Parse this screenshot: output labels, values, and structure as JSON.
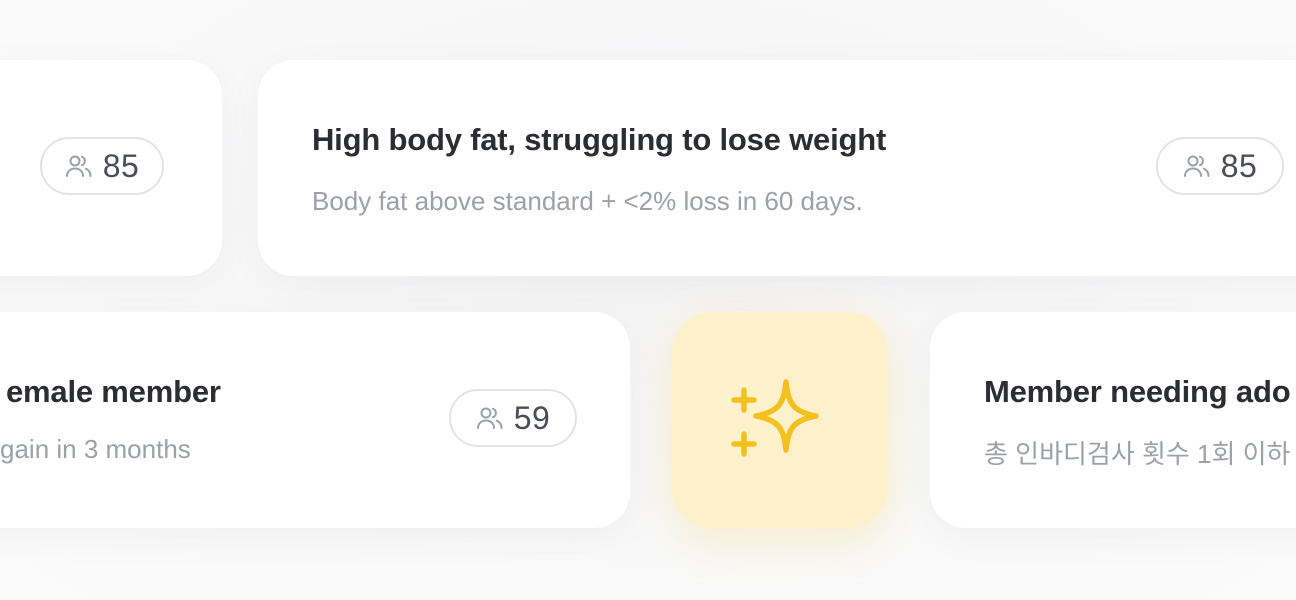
{
  "cards": [
    {
      "title": "",
      "subtitle": "",
      "count": "85"
    },
    {
      "title": "High body fat, struggling to lose weight",
      "subtitle": "Body fat above standard + <2% loss in 60 days.",
      "count": "85"
    },
    {
      "title": "emale member",
      "subtitle": "gain in 3 months",
      "count": "59"
    },
    {
      "title": "Member needing ado",
      "subtitle": "총 인바디검사 횟수 1회 이하",
      "count": ""
    }
  ],
  "icons": {
    "member_count": "users-icon",
    "ai_suggest": "sparkle-icon"
  },
  "colors": {
    "accent": "#f5c01e",
    "accent_bg": "#fdf1cb",
    "card_bg": "#ffffff",
    "title_text": "#2b2d33",
    "subtitle_text": "#9ca0a8"
  }
}
